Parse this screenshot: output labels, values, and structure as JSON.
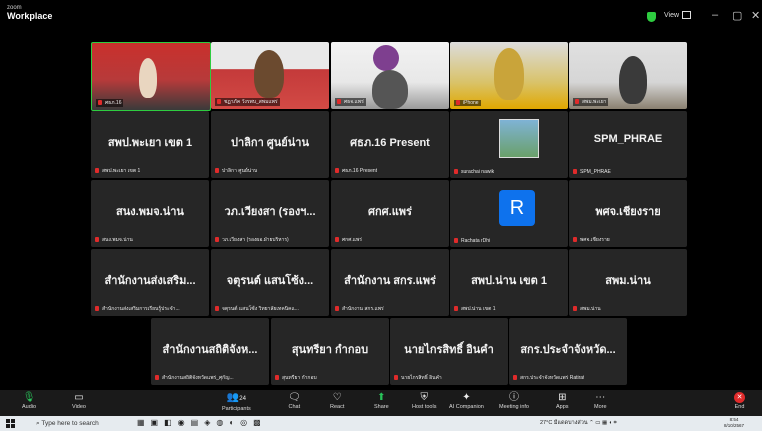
{
  "app": {
    "brand_small": "zoom",
    "brand": "Workplace",
    "view_label": "View"
  },
  "window_controls": [
    "–",
    "▢",
    "✕"
  ],
  "tiles": [
    {
      "id": "t1",
      "big": "",
      "label": "ศธภ.16",
      "video": true
    },
    {
      "id": "t2",
      "big": "",
      "label": "ชฏาภัค วังรพบ_สพมแพร่",
      "video": true
    },
    {
      "id": "t3",
      "big": "",
      "label": "ศธจ.แพร่",
      "video": true
    },
    {
      "id": "t4",
      "big": "",
      "label": "iPhone",
      "video": true
    },
    {
      "id": "t5",
      "big": "",
      "label": "สพม.พะเยา",
      "video": true
    },
    {
      "id": "t6",
      "big": "สพป.พะเยา เขต 1",
      "label": "สพป.พะเยา เขต 1"
    },
    {
      "id": "t7",
      "big": "ปาลิกา ศูนย์น่าน",
      "label": "ปาลิกา ศูนย์น่าน"
    },
    {
      "id": "t8",
      "big": "ศธภ.16 Present",
      "label": "ศธภ.16 Present"
    },
    {
      "id": "t9",
      "big": "",
      "label": "surachai nawik"
    },
    {
      "id": "t10",
      "big": "SPM_PHRAE",
      "label": "SPM_PHRAE"
    },
    {
      "id": "t11",
      "big": "สนง.พมจ.น่าน",
      "label": "สนง.พมจ.น่าน"
    },
    {
      "id": "t12",
      "big": "วภ.เวียงสา (รองฯ...",
      "label": "วภ.เวียงสา (รองผอ.ฝ่ายบริหาร)"
    },
    {
      "id": "t13",
      "big": "ศกศ.แพร่",
      "label": "ศกศ.แพร่"
    },
    {
      "id": "t14",
      "big": "",
      "label": "Rachata rDhi",
      "avatar": "R"
    },
    {
      "id": "t15",
      "big": "พศจ.เชียงราย",
      "label": "พศจ.เชียงราย"
    },
    {
      "id": "t16",
      "big": "สำนักงานส่งเสริม...",
      "label": "สำนักงานส่งเสริมการเรียนรู้ประจำ..."
    },
    {
      "id": "t17",
      "big": "จตุรนต์ แสนโซ้ง...",
      "label": "จตุรนต์ แสนโซ้ง วิทยาลัยเทคนิคแ..."
    },
    {
      "id": "t18",
      "big": "สำนักงาน สกร.แพร่",
      "label": "สำนักงาน สกร.แพร่"
    },
    {
      "id": "t19",
      "big": "สพป.น่าน เขต 1",
      "label": "สพป.น่าน เขต 1"
    },
    {
      "id": "t20",
      "big": "สพม.น่าน",
      "label": "สพม.น่าน"
    },
    {
      "id": "t21",
      "big": "สำนักงานสถิติจังห...",
      "label": "สำนักงานสถิติจังหวัดแพร่_ศุกัญ..."
    },
    {
      "id": "t22",
      "big": "สุนทรียา กำกอบ",
      "label": "สุนทรียา กำกอบ"
    },
    {
      "id": "t23",
      "big": "นายไกรสิทธิ์ อินคำ",
      "label": "นายไกรสิทธิ์ อินคำ"
    },
    {
      "id": "t24",
      "big": "สกร.ประจำจังหวัด...",
      "label": "สกร.ประจำจังหวัดแพร่ Ratirat"
    }
  ],
  "toolbar": {
    "audio": "Audio",
    "video": "Video",
    "participants": "Participants",
    "participants_count": "24",
    "chat": "Chat",
    "react": "React",
    "share": "Share",
    "host_tools": "Host tools",
    "ai_companion": "AI Companion",
    "meeting_info": "Meeting info",
    "apps": "Apps",
    "more": "More",
    "end": "End"
  },
  "taskbar": {
    "search_placeholder": "Type here to search",
    "weather": "27°C มีแดดบางส่วน",
    "time": "8:54",
    "date": "8/10/2567"
  },
  "colors": {
    "tile_bg": "#262626",
    "end_red": "#e02b2b",
    "share_green": "#29c45a",
    "accent_blue": "#0e72ed"
  }
}
